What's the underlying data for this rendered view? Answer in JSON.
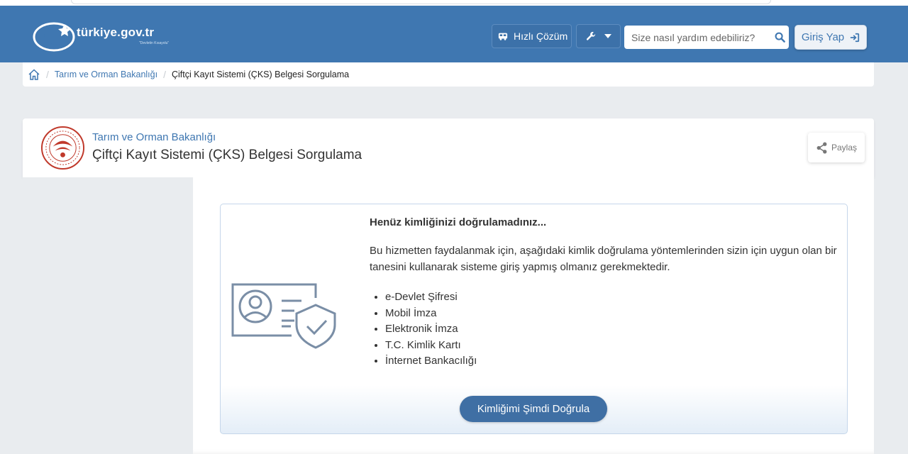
{
  "header": {
    "logo_text": "türkiye.gov.tr",
    "logo_sub": "\"Devletin Kısayolu\"",
    "quick_solution_label": "Hızlı Çözüm",
    "tools_icon": "wrench-icon",
    "search_placeholder": "Size nasıl yardım edebiliriz?",
    "login_label": "Giriş Yap",
    "brand_color": "#3f77b1"
  },
  "breadcrumb": {
    "items": [
      {
        "label": "Tarım ve Orman Bakanlığı"
      },
      {
        "label": "Çiftçi Kayıt Sistemi (ÇKS) Belgesi Sorgulama"
      }
    ]
  },
  "page": {
    "ministry": "Tarım ve Orman Bakanlığı",
    "title": "Çiftçi Kayıt Sistemi (ÇKS) Belgesi Sorgulama",
    "share_label": "Paylaş"
  },
  "auth": {
    "heading": "Henüz kimliğinizi doğrulamadınız...",
    "description": "Bu hizmetten faydalanmak için, aşağıdaki kimlik doğrulama yöntemlerinden sizin için uygun olan bir tanesini kullanarak sisteme giriş yapmış olmanız gerekmektedir.",
    "methods": [
      "e-Devlet Şifresi",
      "Mobil İmza",
      "Elektronik İmza",
      "T.C. Kimlik Kartı",
      "İnternet Bankacılığı"
    ],
    "verify_button": "Kimliğimi Şimdi Doğrula"
  }
}
